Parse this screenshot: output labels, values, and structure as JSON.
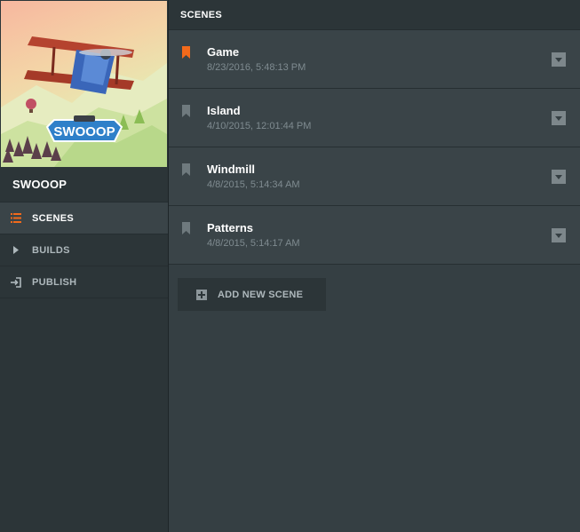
{
  "project": {
    "logo_text": "SWOOOP",
    "name": "SWOOOP"
  },
  "nav": {
    "items": [
      {
        "label": "SCENES",
        "icon": "list-icon",
        "active": true
      },
      {
        "label": "BUILDS",
        "icon": "play-triangle-icon",
        "active": false
      },
      {
        "label": "PUBLISH",
        "icon": "publish-icon",
        "active": false
      }
    ]
  },
  "main": {
    "header": "SCENES",
    "scenes": [
      {
        "name": "Game",
        "date": "8/23/2016, 5:48:13 PM",
        "starred": true
      },
      {
        "name": "Island",
        "date": "4/10/2015, 12:01:44 PM",
        "starred": false
      },
      {
        "name": "Windmill",
        "date": "4/8/2015, 5:14:34 AM",
        "starred": false
      },
      {
        "name": "Patterns",
        "date": "4/8/2015, 5:14:17 AM",
        "starred": false
      }
    ],
    "add_button": "ADD NEW SCENE"
  },
  "colors": {
    "accent": "#f26a1b",
    "bookmark_inactive": "#6f7a7e"
  }
}
